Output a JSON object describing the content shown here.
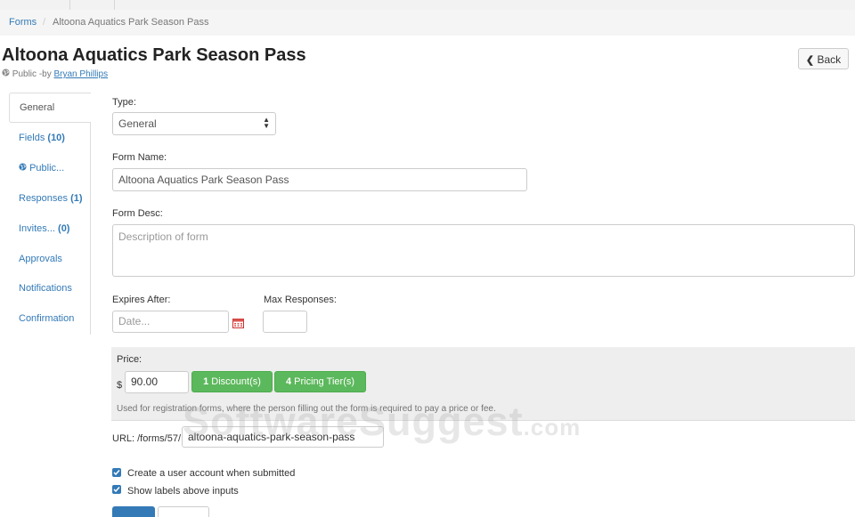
{
  "breadcrumb": {
    "root": "Forms",
    "separator": "/",
    "current": "Altoona Aquatics Park Season Pass"
  },
  "header": {
    "title": "Altoona Aquatics Park Season Pass",
    "visibility_icon": "globe-icon",
    "visibility": "Public",
    "by_prefix": "-by",
    "author": "Bryan Phillips",
    "back_icon": "chevron-left-icon",
    "back_label": "Back"
  },
  "sidebar": {
    "items": [
      {
        "label": "General",
        "active": true
      },
      {
        "label": "Fields",
        "count": "(10)"
      },
      {
        "label": "Public...",
        "icon": "globe-icon"
      },
      {
        "label": "Responses",
        "count": "(1)"
      },
      {
        "label": "Invites...",
        "count": "(0)"
      },
      {
        "label": "Approvals"
      },
      {
        "label": "Notifications"
      },
      {
        "label": "Confirmation"
      }
    ]
  },
  "form": {
    "type_label": "Type:",
    "type_value": "General",
    "name_label": "Form Name:",
    "name_value": "Altoona Aquatics Park Season Pass",
    "desc_label": "Form Desc:",
    "desc_placeholder": "Description of form",
    "expires_label": "Expires After:",
    "expires_placeholder": "Date...",
    "calendar_icon": "calendar-icon",
    "max_label": "Max Responses:",
    "max_value": "",
    "price_label": "Price:",
    "currency": "$",
    "price_value": "90.00",
    "discount_count": "1",
    "discount_label": "Discount(s)",
    "tier_count": "4",
    "tier_label": "Pricing Tier(s)",
    "price_help": "Used for registration forms, where the person filling out the form is required to pay a price or fee.",
    "url_label": "URL: /forms/57/",
    "url_value": "altoona-aquatics-park-season-pass",
    "create_account_label": "Create a user account when submitted",
    "create_account_checked": true,
    "show_labels_label": "Show labels above inputs",
    "show_labels_checked": true
  },
  "watermark": {
    "text": "SoftwareSuggest",
    "suffix": ".com"
  },
  "colors": {
    "link": "#337ab7",
    "green": "#5cb85c",
    "panel": "#eeeeee"
  }
}
